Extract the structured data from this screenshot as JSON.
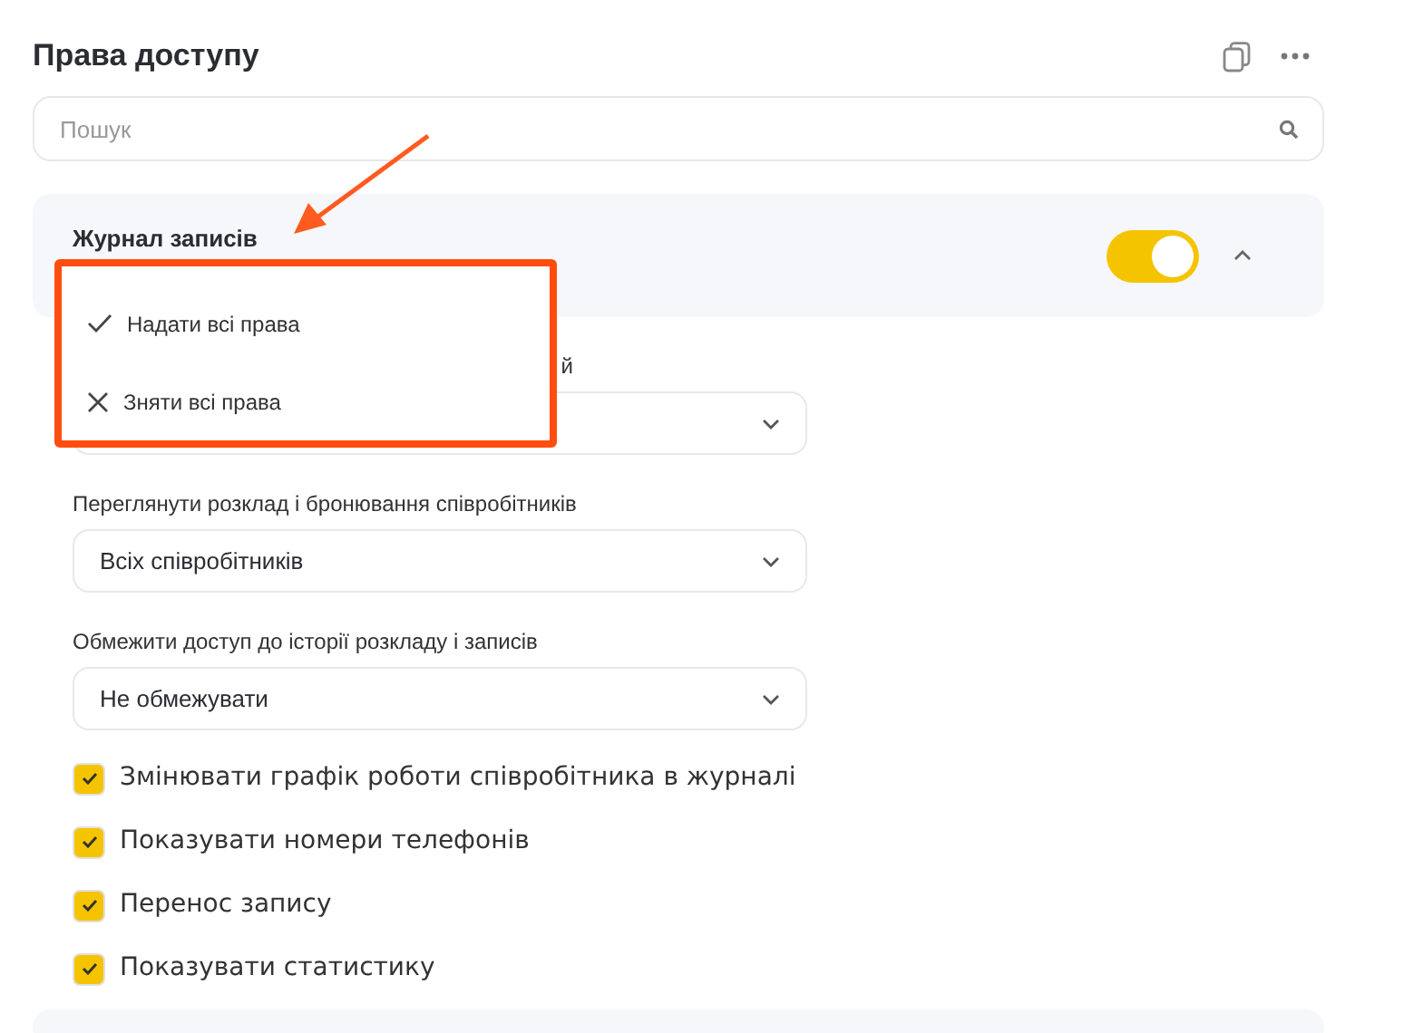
{
  "title": "Права доступу",
  "search": {
    "placeholder": "Пошук"
  },
  "section": {
    "title": "Журнал записів",
    "enabled": true,
    "expanded": true,
    "menu": [
      {
        "kind": "check",
        "label": "Надати всі права"
      },
      {
        "kind": "cross",
        "label": "Зняти всі права"
      }
    ],
    "selects": [
      {
        "label": "й"
      },
      {
        "label": "Переглянути розклад і бронювання співробітників",
        "value": "Всіх співробітників"
      },
      {
        "label": "Обмежити доступ до історії розкладу і записів",
        "value": "Не обмежувати"
      }
    ],
    "checkboxes": [
      {
        "label": "Змінювати графік роботи співробітника в журналі",
        "checked": true
      },
      {
        "label": "Показувати номери телефонів",
        "checked": true
      },
      {
        "label": "Перенос запису",
        "checked": true
      },
      {
        "label": "Показувати статистику",
        "checked": true
      }
    ]
  }
}
